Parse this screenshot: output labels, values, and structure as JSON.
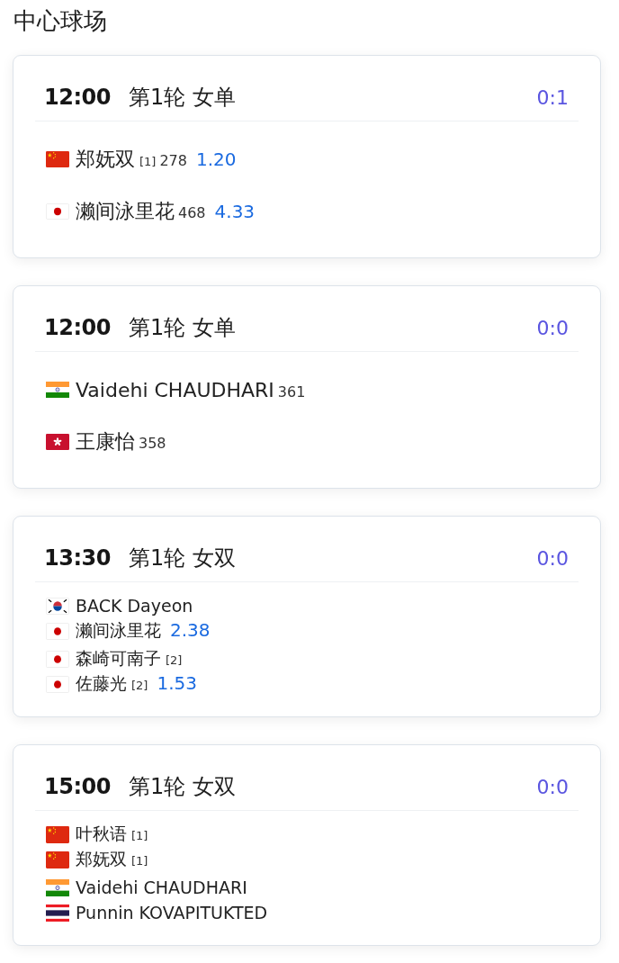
{
  "page": {
    "title": "中心球场"
  },
  "matches": [
    {
      "time": "12:00",
      "round": "第1轮 女单",
      "score": "0:1",
      "kind": "singles",
      "sides": [
        {
          "players": [
            {
              "kind": "china",
              "name": "郑妩双",
              "seed": "[1]",
              "rank": "278",
              "odds": "1.20"
            }
          ]
        },
        {
          "players": [
            {
              "kind": "japan",
              "name": "濑间泳里花",
              "rank": "468",
              "odds": "4.33"
            }
          ]
        }
      ]
    },
    {
      "time": "12:00",
      "round": "第1轮 女单",
      "score": "0:0",
      "kind": "singles",
      "sides": [
        {
          "players": [
            {
              "kind": "india",
              "name": "Vaidehi CHAUDHARI",
              "rank": "361"
            }
          ]
        },
        {
          "players": [
            {
              "kind": "hongkong",
              "name": "王康怡",
              "rank": "358"
            }
          ]
        }
      ]
    },
    {
      "time": "13:30",
      "round": "第1轮 女双",
      "score": "0:0",
      "kind": "doubles",
      "sides": [
        {
          "players": [
            {
              "kind": "korea",
              "name": "BACK Dayeon"
            },
            {
              "kind": "japan",
              "name": "濑间泳里花",
              "odds": "2.38"
            }
          ]
        },
        {
          "players": [
            {
              "kind": "japan",
              "name": "森崎可南子",
              "seed": "[2]"
            },
            {
              "kind": "japan",
              "name": "佐藤光",
              "seed": "[2]",
              "odds": "1.53"
            }
          ]
        }
      ]
    },
    {
      "time": "15:00",
      "round": "第1轮 女双",
      "score": "0:0",
      "kind": "doubles",
      "sides": [
        {
          "players": [
            {
              "kind": "china",
              "name": "叶秋语",
              "seed": "[1]"
            },
            {
              "kind": "china",
              "name": "郑妩双",
              "seed": "[1]"
            }
          ]
        },
        {
          "players": [
            {
              "kind": "india",
              "name": "Vaidehi CHAUDHARI"
            },
            {
              "kind": "thailand",
              "name": "Punnin KOVAPITUKTED"
            }
          ]
        }
      ]
    }
  ]
}
